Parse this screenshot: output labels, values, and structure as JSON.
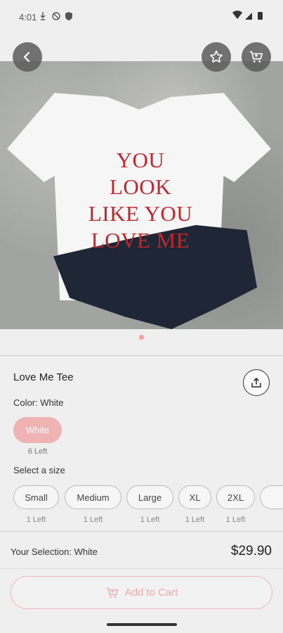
{
  "status_bar": {
    "time": "4:01"
  },
  "product": {
    "name": "Love Me Tee",
    "color_label": "Color: White",
    "color_options": [
      {
        "label": "White",
        "left": "6 Left"
      }
    ],
    "size_label": "Select a size",
    "sizes": [
      {
        "label": "Small",
        "left": "1 Left"
      },
      {
        "label": "Medium",
        "left": "1 Left"
      },
      {
        "label": "Large",
        "left": "1 Left"
      },
      {
        "label": "XL",
        "left": "1 Left"
      },
      {
        "label": "2XL",
        "left": "1 Left"
      }
    ],
    "image_text": [
      "YOU LOOK",
      "LIKE YOU",
      "LOVE ME"
    ]
  },
  "footer": {
    "selection": "Your Selection: White",
    "price": "$29.90",
    "add_to_cart": "Add to Cart"
  },
  "colors": {
    "accent": "#efb3b4",
    "accent_text": "#eda9aa",
    "shirt_text": "#c1272d"
  }
}
